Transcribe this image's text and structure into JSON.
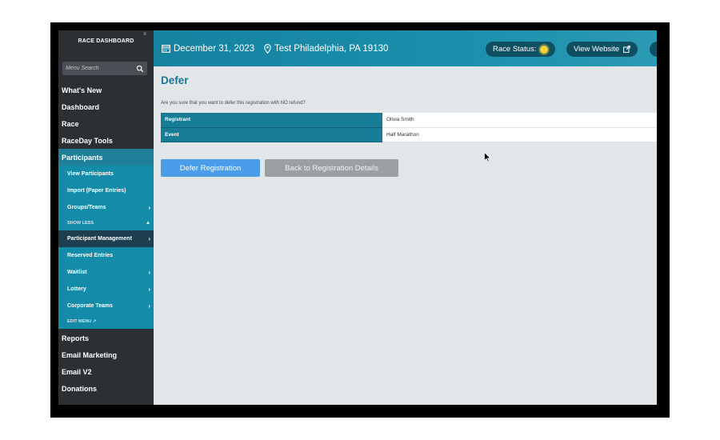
{
  "sidebar": {
    "brand": "RACE DASHBOARD",
    "search_placeholder": "Menu Search",
    "nav_top": [
      {
        "label": "What's New"
      },
      {
        "label": "Dashboard"
      },
      {
        "label": "Race"
      },
      {
        "label": "RaceDay Tools"
      },
      {
        "label": "Participants"
      }
    ],
    "participants_sub": [
      {
        "label": "View Participants"
      },
      {
        "label": "Import (Paper Entries)"
      },
      {
        "label": "Groups/Teams"
      },
      {
        "label": "SHOW LESS"
      },
      {
        "label": "Participant Management"
      },
      {
        "label": "Reserved Entries"
      },
      {
        "label": "Waitlist"
      },
      {
        "label": "Lottery"
      },
      {
        "label": "Corporate Teams"
      },
      {
        "label": "EDIT MENU"
      }
    ],
    "nav_bottom": [
      {
        "label": "Reports"
      },
      {
        "label": "Email Marketing"
      },
      {
        "label": "Email V2"
      },
      {
        "label": "Donations"
      }
    ]
  },
  "header": {
    "date": "December 31, 2023",
    "location": "Test Philadelphia, PA 19130",
    "race_status_label": "Race Status:",
    "view_website_label": "View Website"
  },
  "page": {
    "title": "Defer",
    "question": "Are you sure that you want to defer this registration with NO refund?",
    "rows": [
      {
        "key": "Registrant",
        "value": "Olivia Smith"
      },
      {
        "key": "Event",
        "value": "Half Marathon"
      }
    ],
    "defer_button": "Defer Registration",
    "back_button": "Back to Registration Details"
  },
  "colors": {
    "accent": "#1a8fad",
    "sidebar": "#2c3035",
    "primary_button": "#4a9de8",
    "secondary_button": "#9aa0a4"
  }
}
